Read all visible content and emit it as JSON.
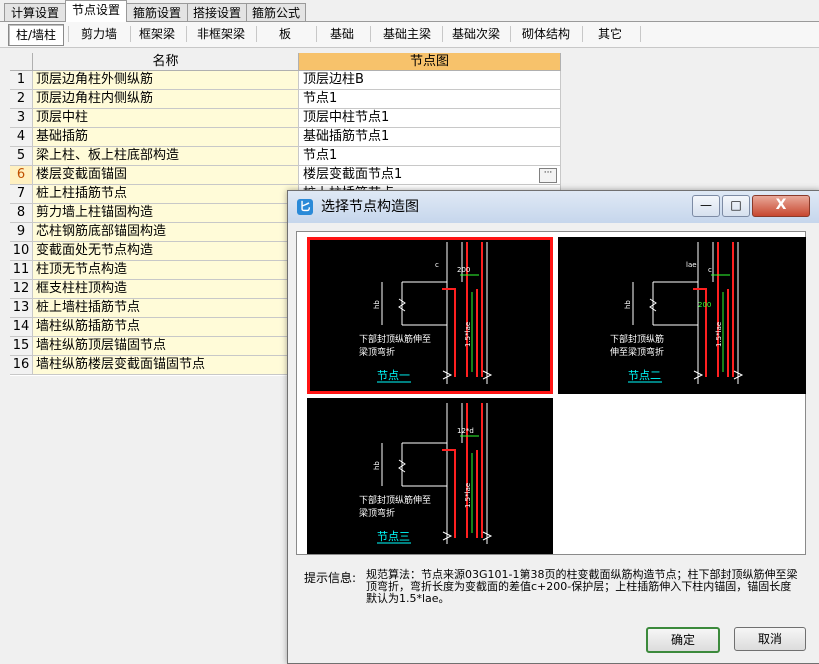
{
  "top_tabs": [
    "计算设置",
    "节点设置",
    "箍筋设置",
    "搭接设置",
    "箍筋公式"
  ],
  "active_top_tab": "节点设置",
  "sub_tabs": [
    "柱/墙柱",
    "剪力墙",
    "框架梁",
    "非框架梁",
    "板",
    "基础",
    "基础主梁",
    "基础次梁",
    "砌体结构",
    "其它"
  ],
  "active_sub_tab": "柱/墙柱",
  "grid": {
    "header_name": "名称",
    "header_value": "节点图",
    "rows": [
      {
        "num": "1",
        "name": "顶层边角柱外侧纵筋",
        "value": "顶层边柱B"
      },
      {
        "num": "2",
        "name": "顶层边角柱内侧纵筋",
        "value": "节点1"
      },
      {
        "num": "3",
        "name": "顶层中柱",
        "value": "顶层中柱节点1"
      },
      {
        "num": "4",
        "name": "基础插筋",
        "value": "基础插筋节点1"
      },
      {
        "num": "5",
        "name": "梁上柱、板上柱底部构造",
        "value": "节点1"
      },
      {
        "num": "6",
        "name": "楼层变截面锚固",
        "value": "楼层变截面节点1"
      },
      {
        "num": "7",
        "name": "桩上柱插筋节点",
        "value": "桩上柱插筋节点"
      },
      {
        "num": "8",
        "name": "剪力墙上柱锚固构造",
        "value": ""
      },
      {
        "num": "9",
        "name": "芯柱钢筋底部锚固构造",
        "value": ""
      },
      {
        "num": "10",
        "name": "变截面处无节点构造",
        "value": ""
      },
      {
        "num": "11",
        "name": "柱顶无节点构造",
        "value": ""
      },
      {
        "num": "12",
        "name": "框支柱柱顶构造",
        "value": ""
      },
      {
        "num": "13",
        "name": "桩上墙柱插筋节点",
        "value": ""
      },
      {
        "num": "14",
        "name": "墙柱纵筋插筋节点",
        "value": ""
      },
      {
        "num": "15",
        "name": "墙柱纵筋顶层锚固节点",
        "value": ""
      },
      {
        "num": "16",
        "name": "墙柱纵筋楼层变截面锚固节点",
        "value": ""
      }
    ],
    "selected_row": "6",
    "ellipsis_label": "···"
  },
  "dialog": {
    "title": "选择节点构造图",
    "icon_glyph": "匕",
    "min_label": "—",
    "max_label": "□",
    "close_label": "X",
    "nodes": [
      {
        "name": "节点一",
        "caption_l1": "下部封顶纵筋伸至",
        "caption_l2": "梁顶弯折",
        "dim_top": "200",
        "dim_c": "c",
        "dim_h": "hb",
        "dim_v": "1.5*lae",
        "selected": true
      },
      {
        "name": "节点二",
        "caption_l1": "下部封顶纵筋",
        "caption_l2": "伸至梁顶弯折",
        "dim_top": "c",
        "dim_c": "lae",
        "dim_h": "hb",
        "dim_v": "1.5*lae",
        "dim_200": "200",
        "selected": false
      },
      {
        "name": "节点三",
        "caption_l1": "下部封顶纵筋伸至",
        "caption_l2": "梁顶弯折",
        "dim_top": "12*d",
        "dim_c": "",
        "dim_h": "hb",
        "dim_v": "1.5*lae",
        "selected": false
      }
    ],
    "hint_label": "提示信息:",
    "hint_text": "规范算法：节点来源03G101-1第38页的柱变截面纵筋构造节点；柱下部封顶纵筋伸至梁顶弯折，弯折长度为变截面的差值c+200-保护层；上柱插筋伸入下柱内锚固，锚固长度默认为1.5*lae。",
    "ok_label": "确定",
    "cancel_label": "取消"
  },
  "colors": {
    "name_cell_bg": "#fffbd8",
    "header_value_bg": "#f7c26b",
    "selected_border": "#ff1414",
    "node_label": "#00ffff",
    "rebar_red": "#ff2020",
    "dim_green": "#30ff30"
  }
}
